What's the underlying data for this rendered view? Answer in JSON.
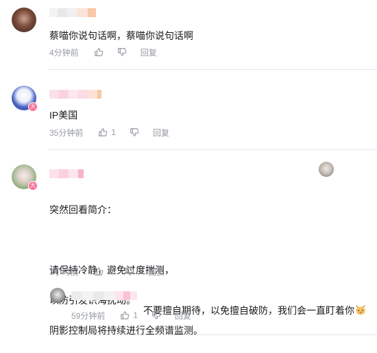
{
  "comments": [
    {
      "text": "蔡喵你说句话啊，蔡喵你说句话啊",
      "time": "4分钟前",
      "likes": "",
      "reply_label": "回复"
    },
    {
      "text": "IP美国",
      "time": "35分钟前",
      "likes": "1",
      "reply_label": "回复",
      "badge": "大"
    },
    {
      "text_lines": [
        "突然回看简介：",
        "",
        "请保持冷静，避免过度揣测，",
        "以防引发识海扰动。",
        "阴影控制局将持续进行全频谱监测。"
      ],
      "time": "3小时前",
      "likes": "3",
      "reply_label": "回复",
      "badge": "大",
      "sub_reply": {
        "text": "不要擅自期待，以免擅自破防，我们会一直盯着你",
        "time": "59分钟前",
        "likes": "1",
        "reply_label": "回复"
      }
    }
  ],
  "colors": {
    "accent": "#fb7299",
    "meta": "#9499a0",
    "divider": "#e3e5e7"
  },
  "icons": [
    "like-icon",
    "dislike-icon",
    "cat-emoji-icon"
  ]
}
